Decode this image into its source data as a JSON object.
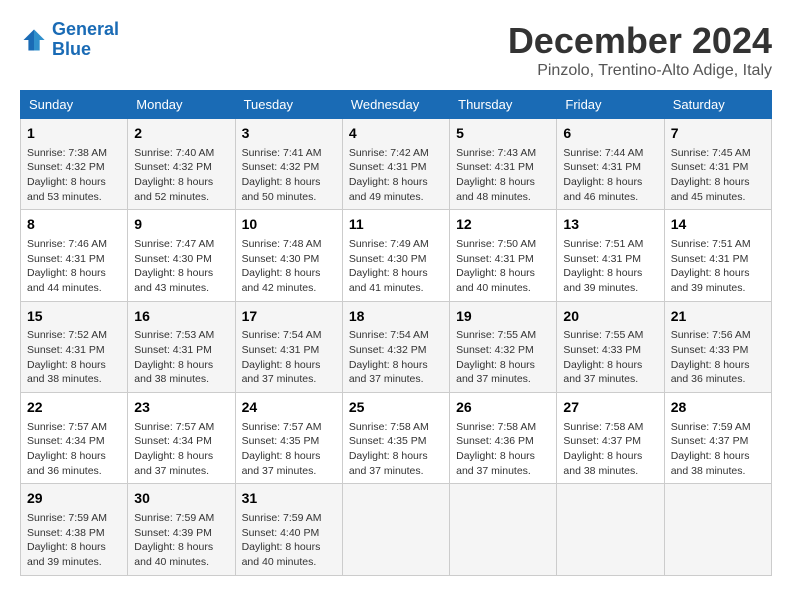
{
  "header": {
    "logo_line1": "General",
    "logo_line2": "Blue",
    "month_title": "December 2024",
    "location": "Pinzolo, Trentino-Alto Adige, Italy"
  },
  "days_of_week": [
    "Sunday",
    "Monday",
    "Tuesday",
    "Wednesday",
    "Thursday",
    "Friday",
    "Saturday"
  ],
  "weeks": [
    [
      {
        "day": "1",
        "sunrise": "Sunrise: 7:38 AM",
        "sunset": "Sunset: 4:32 PM",
        "daylight": "Daylight: 8 hours and 53 minutes."
      },
      {
        "day": "2",
        "sunrise": "Sunrise: 7:40 AM",
        "sunset": "Sunset: 4:32 PM",
        "daylight": "Daylight: 8 hours and 52 minutes."
      },
      {
        "day": "3",
        "sunrise": "Sunrise: 7:41 AM",
        "sunset": "Sunset: 4:32 PM",
        "daylight": "Daylight: 8 hours and 50 minutes."
      },
      {
        "day": "4",
        "sunrise": "Sunrise: 7:42 AM",
        "sunset": "Sunset: 4:31 PM",
        "daylight": "Daylight: 8 hours and 49 minutes."
      },
      {
        "day": "5",
        "sunrise": "Sunrise: 7:43 AM",
        "sunset": "Sunset: 4:31 PM",
        "daylight": "Daylight: 8 hours and 48 minutes."
      },
      {
        "day": "6",
        "sunrise": "Sunrise: 7:44 AM",
        "sunset": "Sunset: 4:31 PM",
        "daylight": "Daylight: 8 hours and 46 minutes."
      },
      {
        "day": "7",
        "sunrise": "Sunrise: 7:45 AM",
        "sunset": "Sunset: 4:31 PM",
        "daylight": "Daylight: 8 hours and 45 minutes."
      }
    ],
    [
      {
        "day": "8",
        "sunrise": "Sunrise: 7:46 AM",
        "sunset": "Sunset: 4:31 PM",
        "daylight": "Daylight: 8 hours and 44 minutes."
      },
      {
        "day": "9",
        "sunrise": "Sunrise: 7:47 AM",
        "sunset": "Sunset: 4:30 PM",
        "daylight": "Daylight: 8 hours and 43 minutes."
      },
      {
        "day": "10",
        "sunrise": "Sunrise: 7:48 AM",
        "sunset": "Sunset: 4:30 PM",
        "daylight": "Daylight: 8 hours and 42 minutes."
      },
      {
        "day": "11",
        "sunrise": "Sunrise: 7:49 AM",
        "sunset": "Sunset: 4:30 PM",
        "daylight": "Daylight: 8 hours and 41 minutes."
      },
      {
        "day": "12",
        "sunrise": "Sunrise: 7:50 AM",
        "sunset": "Sunset: 4:31 PM",
        "daylight": "Daylight: 8 hours and 40 minutes."
      },
      {
        "day": "13",
        "sunrise": "Sunrise: 7:51 AM",
        "sunset": "Sunset: 4:31 PM",
        "daylight": "Daylight: 8 hours and 39 minutes."
      },
      {
        "day": "14",
        "sunrise": "Sunrise: 7:51 AM",
        "sunset": "Sunset: 4:31 PM",
        "daylight": "Daylight: 8 hours and 39 minutes."
      }
    ],
    [
      {
        "day": "15",
        "sunrise": "Sunrise: 7:52 AM",
        "sunset": "Sunset: 4:31 PM",
        "daylight": "Daylight: 8 hours and 38 minutes."
      },
      {
        "day": "16",
        "sunrise": "Sunrise: 7:53 AM",
        "sunset": "Sunset: 4:31 PM",
        "daylight": "Daylight: 8 hours and 38 minutes."
      },
      {
        "day": "17",
        "sunrise": "Sunrise: 7:54 AM",
        "sunset": "Sunset: 4:31 PM",
        "daylight": "Daylight: 8 hours and 37 minutes."
      },
      {
        "day": "18",
        "sunrise": "Sunrise: 7:54 AM",
        "sunset": "Sunset: 4:32 PM",
        "daylight": "Daylight: 8 hours and 37 minutes."
      },
      {
        "day": "19",
        "sunrise": "Sunrise: 7:55 AM",
        "sunset": "Sunset: 4:32 PM",
        "daylight": "Daylight: 8 hours and 37 minutes."
      },
      {
        "day": "20",
        "sunrise": "Sunrise: 7:55 AM",
        "sunset": "Sunset: 4:33 PM",
        "daylight": "Daylight: 8 hours and 37 minutes."
      },
      {
        "day": "21",
        "sunrise": "Sunrise: 7:56 AM",
        "sunset": "Sunset: 4:33 PM",
        "daylight": "Daylight: 8 hours and 36 minutes."
      }
    ],
    [
      {
        "day": "22",
        "sunrise": "Sunrise: 7:57 AM",
        "sunset": "Sunset: 4:34 PM",
        "daylight": "Daylight: 8 hours and 36 minutes."
      },
      {
        "day": "23",
        "sunrise": "Sunrise: 7:57 AM",
        "sunset": "Sunset: 4:34 PM",
        "daylight": "Daylight: 8 hours and 37 minutes."
      },
      {
        "day": "24",
        "sunrise": "Sunrise: 7:57 AM",
        "sunset": "Sunset: 4:35 PM",
        "daylight": "Daylight: 8 hours and 37 minutes."
      },
      {
        "day": "25",
        "sunrise": "Sunrise: 7:58 AM",
        "sunset": "Sunset: 4:35 PM",
        "daylight": "Daylight: 8 hours and 37 minutes."
      },
      {
        "day": "26",
        "sunrise": "Sunrise: 7:58 AM",
        "sunset": "Sunset: 4:36 PM",
        "daylight": "Daylight: 8 hours and 37 minutes."
      },
      {
        "day": "27",
        "sunrise": "Sunrise: 7:58 AM",
        "sunset": "Sunset: 4:37 PM",
        "daylight": "Daylight: 8 hours and 38 minutes."
      },
      {
        "day": "28",
        "sunrise": "Sunrise: 7:59 AM",
        "sunset": "Sunset: 4:37 PM",
        "daylight": "Daylight: 8 hours and 38 minutes."
      }
    ],
    [
      {
        "day": "29",
        "sunrise": "Sunrise: 7:59 AM",
        "sunset": "Sunset: 4:38 PM",
        "daylight": "Daylight: 8 hours and 39 minutes."
      },
      {
        "day": "30",
        "sunrise": "Sunrise: 7:59 AM",
        "sunset": "Sunset: 4:39 PM",
        "daylight": "Daylight: 8 hours and 40 minutes."
      },
      {
        "day": "31",
        "sunrise": "Sunrise: 7:59 AM",
        "sunset": "Sunset: 4:40 PM",
        "daylight": "Daylight: 8 hours and 40 minutes."
      },
      null,
      null,
      null,
      null
    ]
  ]
}
